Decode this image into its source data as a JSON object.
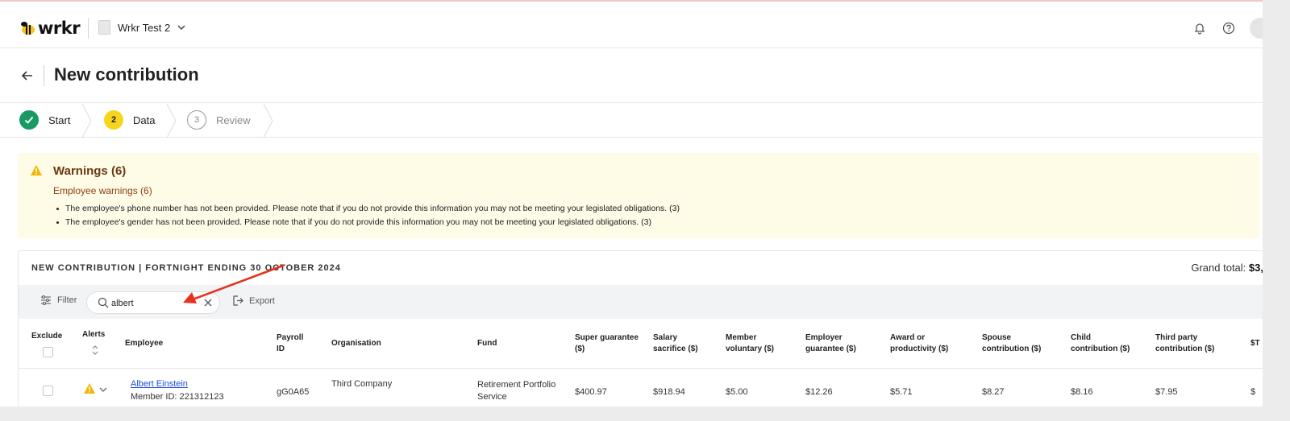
{
  "app": {
    "brand": "wrkr",
    "workspace": "Wrkr Test 2"
  },
  "page": {
    "title": "New contribution"
  },
  "steps": [
    {
      "label": "Start",
      "state": "done"
    },
    {
      "label": "Data",
      "number": "2",
      "state": "active"
    },
    {
      "label": "Review",
      "number": "3",
      "state": "todo"
    }
  ],
  "warnings": {
    "title": "Warnings (6)",
    "subtitle": "Employee warnings (6)",
    "items": [
      "The employee's phone number has not been provided. Please note that if you do not provide this information you may not be meeting your legislated obligations. (3)",
      "The employee's gender has not been provided. Please note that if you do not provide this information you may not be meeting your legislated obligations. (3)"
    ]
  },
  "contribution": {
    "title": "NEW CONTRIBUTION | FORTNIGHT ENDING 30 OCTOBER 2024",
    "grand_total_label": "Grand total:",
    "grand_total_value": "$3,"
  },
  "toolbar": {
    "filter_label": "Filter",
    "search_value": "albert",
    "export_label": "Export"
  },
  "table": {
    "headers": {
      "exclude": "Exclude",
      "alerts": "Alerts",
      "employee": "Employee",
      "payroll_id": "Payroll ID",
      "organisation": "Organisation",
      "fund": "Fund",
      "super_guarantee": "Super guarantee ($)",
      "salary_sacrifice": "Salary sacrifice ($)",
      "member_voluntary": "Member voluntary ($)",
      "employer_guarantee": "Employer guarantee ($)",
      "award": "Award or productivity ($)",
      "spouse": "Spouse contribution ($)",
      "child": "Child contribution ($)",
      "third_party": "Third party contribution ($)",
      "total_partial": "$T"
    },
    "rows": [
      {
        "employee_name": "Albert Einstein",
        "member_id": "Member ID: 221312123",
        "payroll_id": "gG0A65",
        "organisation": "Third Company",
        "fund": "Retirement Portfolio Service",
        "super_guarantee": "$400.97",
        "salary_sacrifice": "$918.94",
        "member_voluntary": "$5.00",
        "employer_guarantee": "$12.26",
        "award": "$5.71",
        "spouse": "$8.27",
        "child": "$8.16",
        "third_party": "$7.95",
        "total_partial": "$"
      }
    ]
  },
  "colors": {
    "done": "#1a9a63",
    "active": "#f7d51e",
    "warning_bg": "#fefbe7",
    "link": "#1d4ed8",
    "annotation_arrow": "#e8321f"
  }
}
